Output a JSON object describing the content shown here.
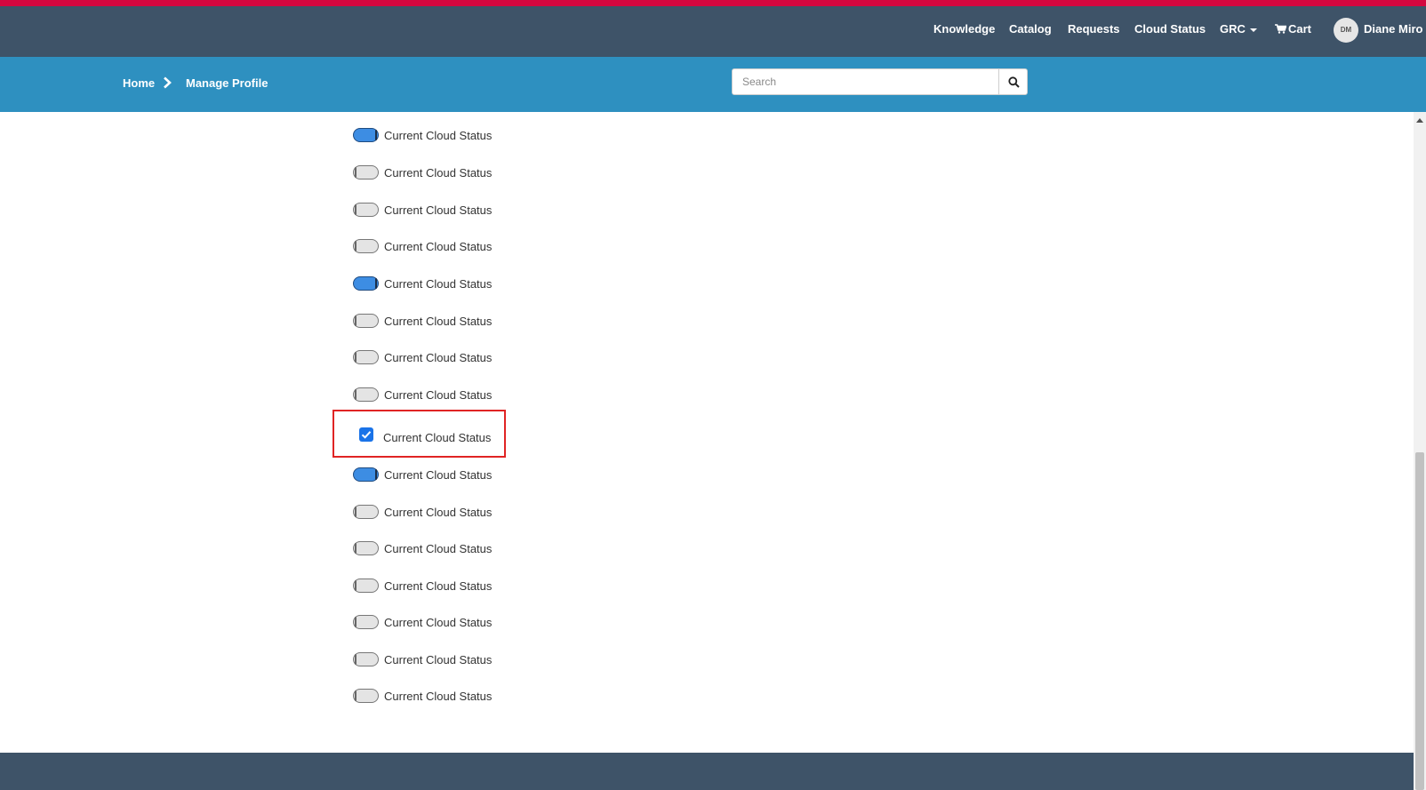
{
  "nav": {
    "items": [
      {
        "label": "Knowledge"
      },
      {
        "label": "Catalog"
      },
      {
        "label": "Requests"
      },
      {
        "label": "Cloud Status"
      },
      {
        "label": "GRC"
      },
      {
        "label": "Cart"
      }
    ],
    "user": {
      "initials": "DM",
      "name": "Diane Miro"
    }
  },
  "breadcrumb": {
    "home": "Home",
    "current": "Manage Profile"
  },
  "search": {
    "placeholder": "Search",
    "value": ""
  },
  "list": {
    "items": [
      {
        "label": "Current Cloud Status",
        "state": "on"
      },
      {
        "label": "Current Cloud Status",
        "state": "off"
      },
      {
        "label": "Current Cloud Status",
        "state": "off"
      },
      {
        "label": "Current Cloud Status",
        "state": "off"
      },
      {
        "label": "Current Cloud Status",
        "state": "on"
      },
      {
        "label": "Current Cloud Status",
        "state": "off"
      },
      {
        "label": "Current Cloud Status",
        "state": "off"
      },
      {
        "label": "Current Cloud Status",
        "state": "off"
      },
      {
        "label": "Current Cloud Status",
        "state": "on"
      },
      {
        "label": "Current Cloud Status",
        "state": "off"
      },
      {
        "label": "Current Cloud Status",
        "state": "off"
      },
      {
        "label": "Current Cloud Status",
        "state": "off"
      },
      {
        "label": "Current Cloud Status",
        "state": "off"
      },
      {
        "label": "Current Cloud Status",
        "state": "off"
      },
      {
        "label": "Current Cloud Status",
        "state": "off"
      }
    ],
    "highlighted": {
      "label": "Current Cloud Status",
      "checked": true
    }
  },
  "colors": {
    "brand_stripe": "#d4073f",
    "nav_bg": "#3e5368",
    "breadcrumb_bg": "#2e90c0",
    "toggle_on": "#3d8de3",
    "toggle_off": "#e4e4e4",
    "checkbox": "#1a73e8",
    "highlight_border": "#e02424"
  }
}
